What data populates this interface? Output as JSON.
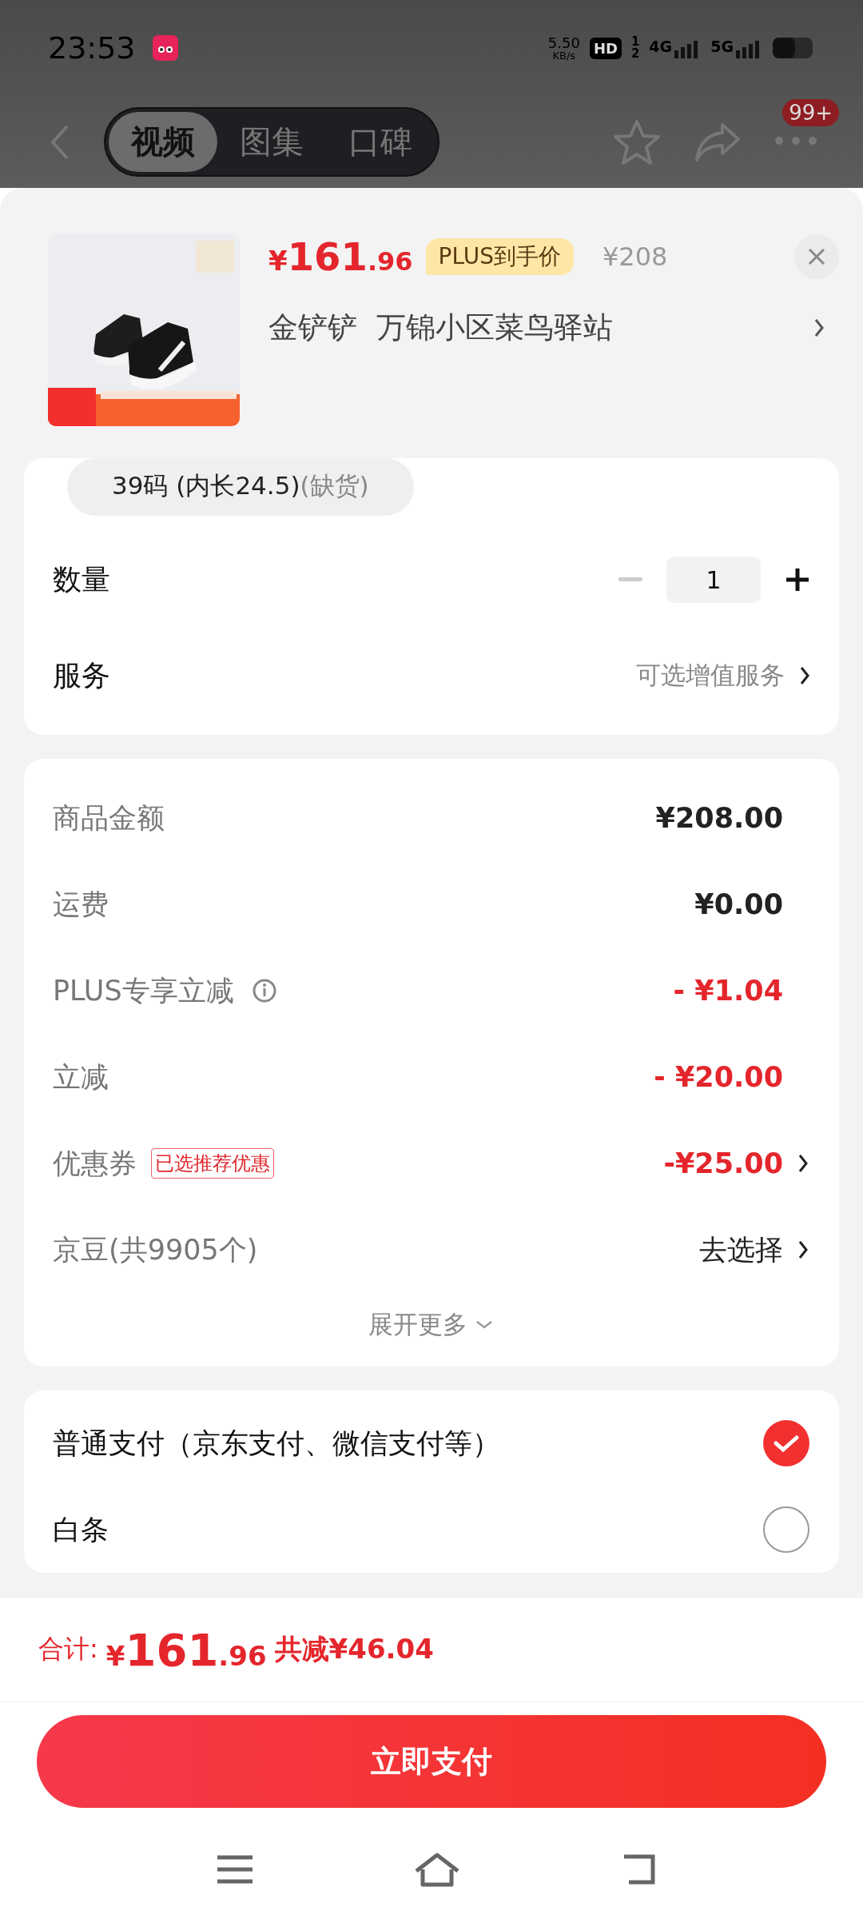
{
  "status_bar": {
    "time": "23:53",
    "speed": "5.50",
    "speed_unit": "KB/s",
    "hd": "HD",
    "sim_slots": [
      "1",
      "2"
    ],
    "networks": [
      "4G",
      "5G"
    ]
  },
  "nav": {
    "tabs": [
      {
        "label": "视频",
        "selected": true
      },
      {
        "label": "图集",
        "selected": false
      },
      {
        "label": "口碑",
        "selected": false
      }
    ],
    "badge": "99+"
  },
  "product": {
    "price": {
      "symbol": "¥",
      "integer": "161",
      "decimal": ".96"
    },
    "price_tag": "PLUS到手价",
    "original_price": "¥208",
    "address": "金铲铲  万锦小区菜鸟驿站"
  },
  "size_option": {
    "label": "39码 (内长24.5)",
    "note": "(缺货)"
  },
  "quantity": {
    "label": "数量",
    "value": "1",
    "minus_disabled": true
  },
  "service": {
    "label": "服务",
    "value": "可选增值服务"
  },
  "summary": [
    {
      "label": "商品金额",
      "value": "¥208.00",
      "kind": "amount",
      "info": false,
      "has_arrow": false
    },
    {
      "label": "运费",
      "value": "¥0.00",
      "kind": "amount",
      "info": false,
      "has_arrow": false
    },
    {
      "label": "PLUS专享立减",
      "value": "- ¥1.04",
      "kind": "discount",
      "info": true,
      "has_arrow": false
    },
    {
      "label": "立减",
      "value": "- ¥20.00",
      "kind": "discount",
      "info": false,
      "has_arrow": false
    },
    {
      "label": "优惠券",
      "tag": "已选推荐优惠",
      "value": "-¥25.00",
      "kind": "discount",
      "info": false,
      "has_arrow": true
    },
    {
      "label": "京豆(共9905个)",
      "value": "去选择",
      "kind": "action",
      "info": false,
      "has_arrow": true
    }
  ],
  "expand_more": "展开更多",
  "payment_methods": [
    {
      "label": "普通支付（京东支付、微信支付等）",
      "selected": true
    },
    {
      "label": "白条",
      "selected": false
    }
  ],
  "total": {
    "label": "合计:",
    "symbol": "¥",
    "integer": "161",
    "decimal": ".96",
    "saved": "共减¥46.04"
  },
  "pay_button": "立即支付"
}
